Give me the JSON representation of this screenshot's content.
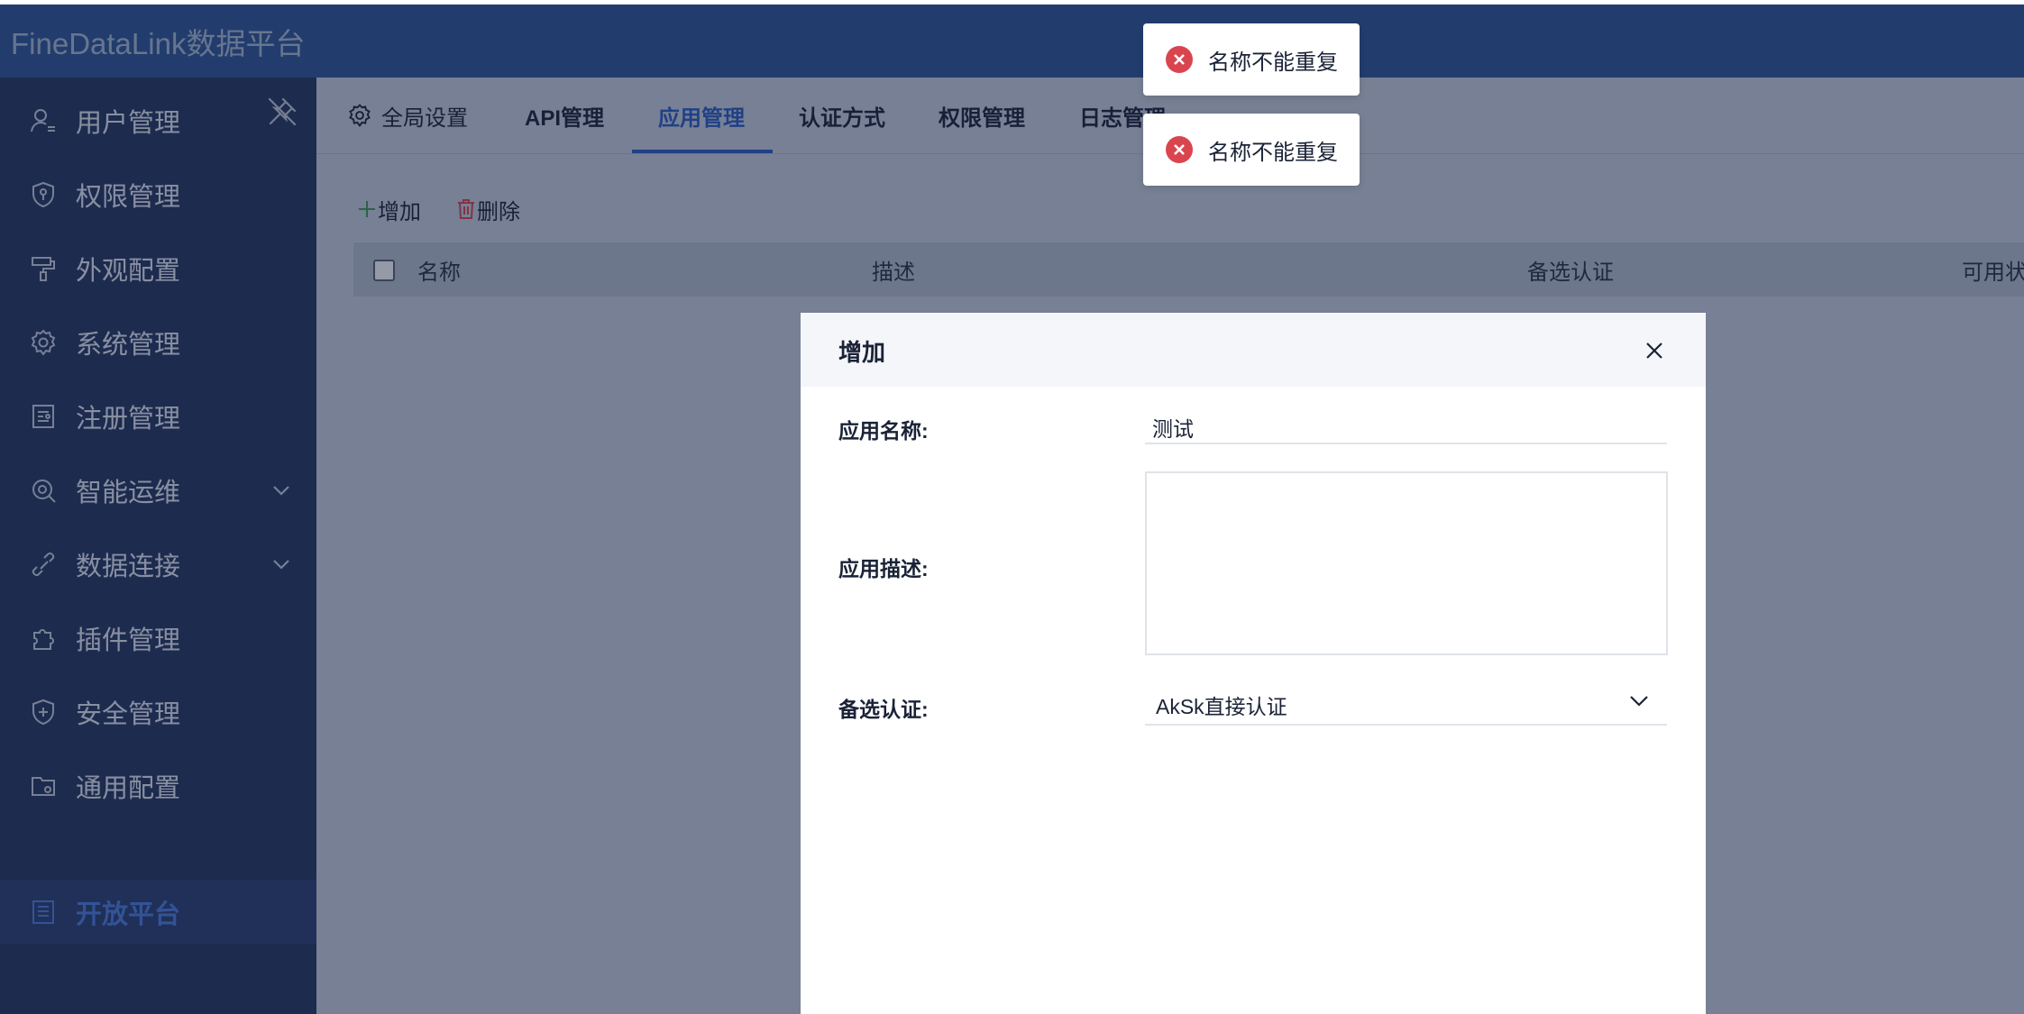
{
  "app": {
    "title": "FineDataLink数据平台"
  },
  "sidebar": {
    "items": [
      {
        "label": "用户管理",
        "icon": "user-icon"
      },
      {
        "label": "权限管理",
        "icon": "permission-shield-icon"
      },
      {
        "label": "外观配置",
        "icon": "paint-roller-icon"
      },
      {
        "label": "系统管理",
        "icon": "gear-icon"
      },
      {
        "label": "注册管理",
        "icon": "register-doc-icon"
      },
      {
        "label": "智能运维",
        "icon": "ops-icon"
      },
      {
        "label": "数据连接",
        "icon": "link-icon"
      },
      {
        "label": "插件管理",
        "icon": "puzzle-icon"
      },
      {
        "label": "安全管理",
        "icon": "security-shield-icon"
      },
      {
        "label": "通用配置",
        "icon": "folder-gear-icon"
      },
      {
        "label": "开放平台",
        "icon": "list-doc-icon",
        "active": true
      }
    ]
  },
  "tabs": [
    {
      "label": "全局设置",
      "icon": "gear-icon"
    },
    {
      "label": "API管理"
    },
    {
      "label": "应用管理",
      "active": true
    },
    {
      "label": "认证方式"
    },
    {
      "label": "权限管理"
    },
    {
      "label": "日志管理"
    }
  ],
  "toolbar": {
    "add_label": "增加",
    "delete_label": "删除"
  },
  "table": {
    "columns": [
      "名称",
      "描述",
      "备选认证",
      "可用状"
    ]
  },
  "modal": {
    "title": "增加",
    "name_label": "应用名称:",
    "name_value": "测试",
    "desc_label": "应用描述:",
    "desc_value": "",
    "auth_label": "备选认证:",
    "auth_value": "AkSk直接认证"
  },
  "toasts": [
    {
      "message": "名称不能重复"
    },
    {
      "message": "名称不能重复"
    }
  ],
  "colors": {
    "topbar": "#2e5795",
    "sidebar": "#253560",
    "accent": "#2b5bc3",
    "error": "#d9454f"
  }
}
